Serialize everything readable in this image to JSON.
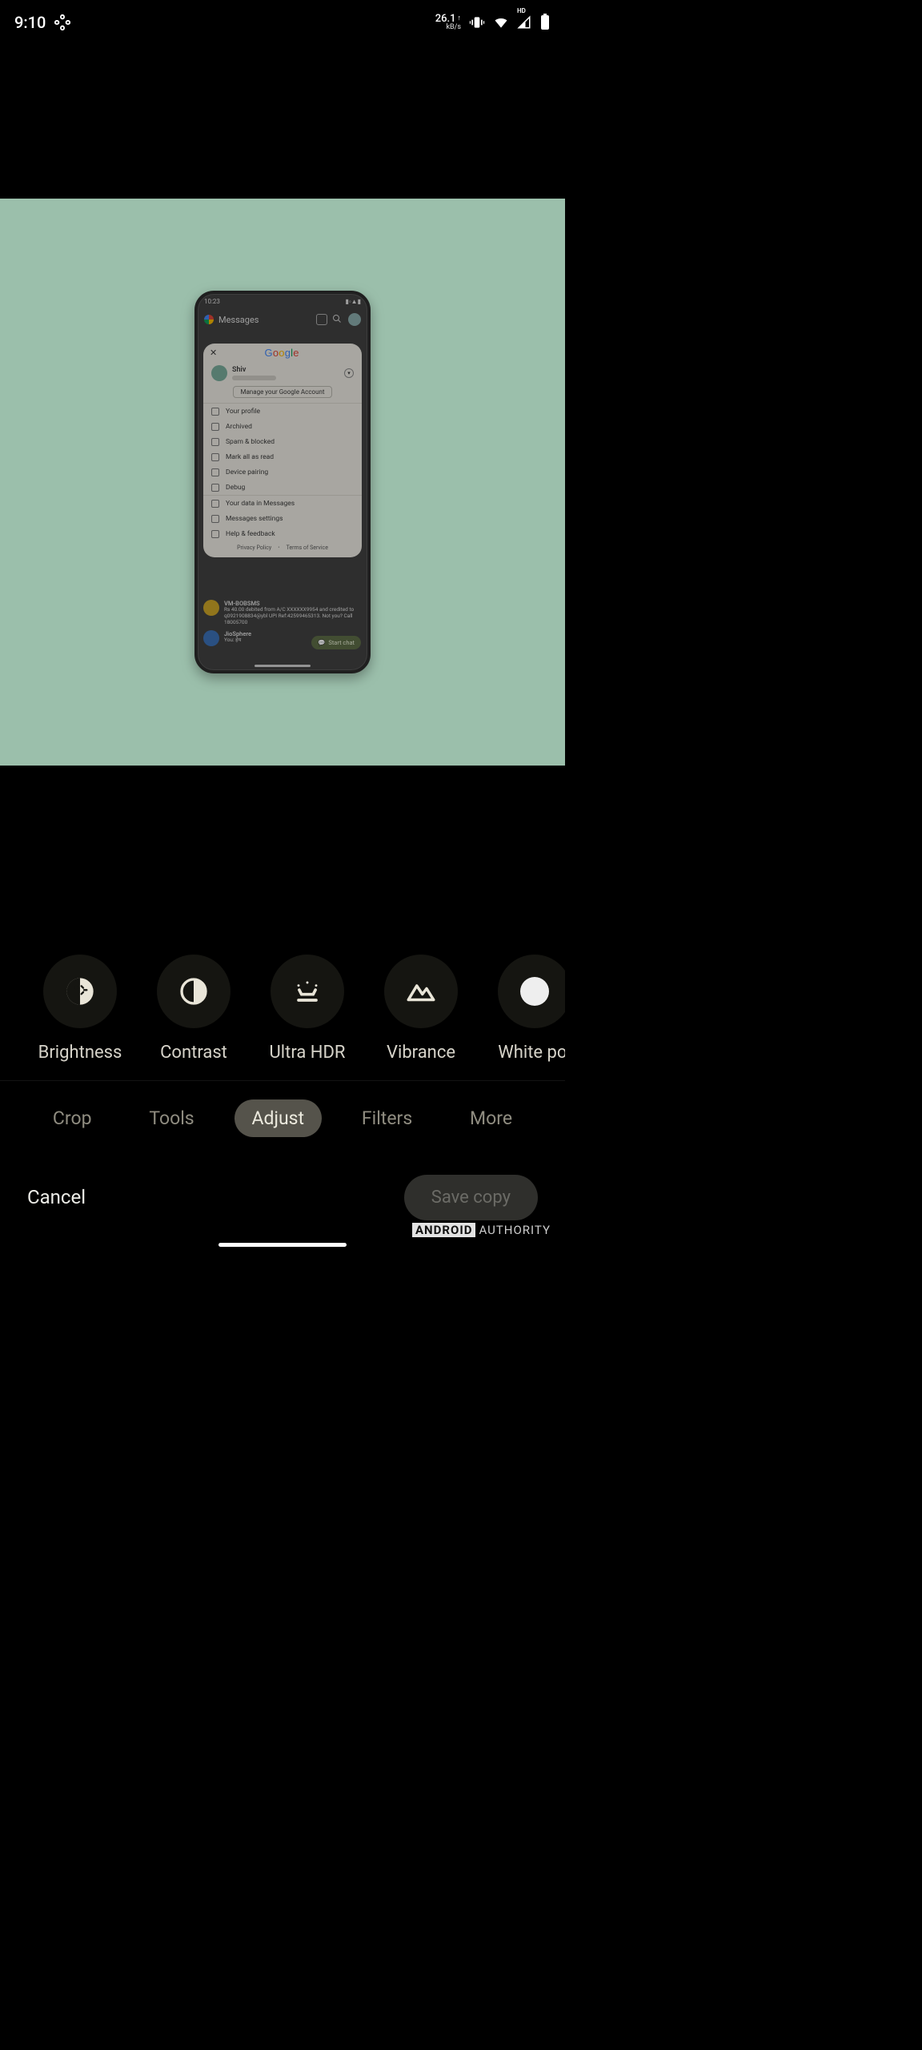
{
  "statusbar": {
    "time": "9:10",
    "net_speed": "26.1",
    "net_unit": "kB/s",
    "signal_label": "HD"
  },
  "edited_image": {
    "inner_statusbar_time": "10:23",
    "app_name": "Messages",
    "account_sheet": {
      "google_word": [
        "G",
        "o",
        "o",
        "g",
        "l",
        "e"
      ],
      "user_name": "Shiv",
      "manage_button": "Manage your Google Account",
      "menu_section_1": [
        "Your profile",
        "Archived",
        "Spam & blocked",
        "Mark all as read",
        "Device pairing",
        "Debug"
      ],
      "menu_section_2": [
        "Your data in Messages",
        "Messages settings",
        "Help & feedback"
      ],
      "footer_privacy": "Privacy Policy",
      "footer_terms": "Terms of Service"
    },
    "bg_messages": {
      "thread1_sender": "VM-BOBSMS",
      "thread1_preview": "Rs 40.00 debited from A/C XXXXXX9954 and credited to q0921908834@ybl UPI Ref:42599465313. Not you? Call 18005700",
      "thread2_sender": "JioSphere",
      "thread2_preview": "You: हेय"
    },
    "start_chat_label": "Start chat"
  },
  "adjust_tools": [
    {
      "key": "brightness",
      "label": "Brightness"
    },
    {
      "key": "contrast",
      "label": "Contrast"
    },
    {
      "key": "ultrahdr",
      "label": "Ultra HDR"
    },
    {
      "key": "vibrance",
      "label": "Vibrance"
    },
    {
      "key": "whitepoint",
      "label": "White poi"
    }
  ],
  "tabs": {
    "crop": "Crop",
    "tools": "Tools",
    "adjust": "Adjust",
    "filters": "Filters",
    "more": "More",
    "active": "adjust"
  },
  "actions": {
    "cancel": "Cancel",
    "save_copy": "Save copy"
  },
  "watermark": {
    "boxed": "ANDROID",
    "rest": "AUTHORITY"
  }
}
